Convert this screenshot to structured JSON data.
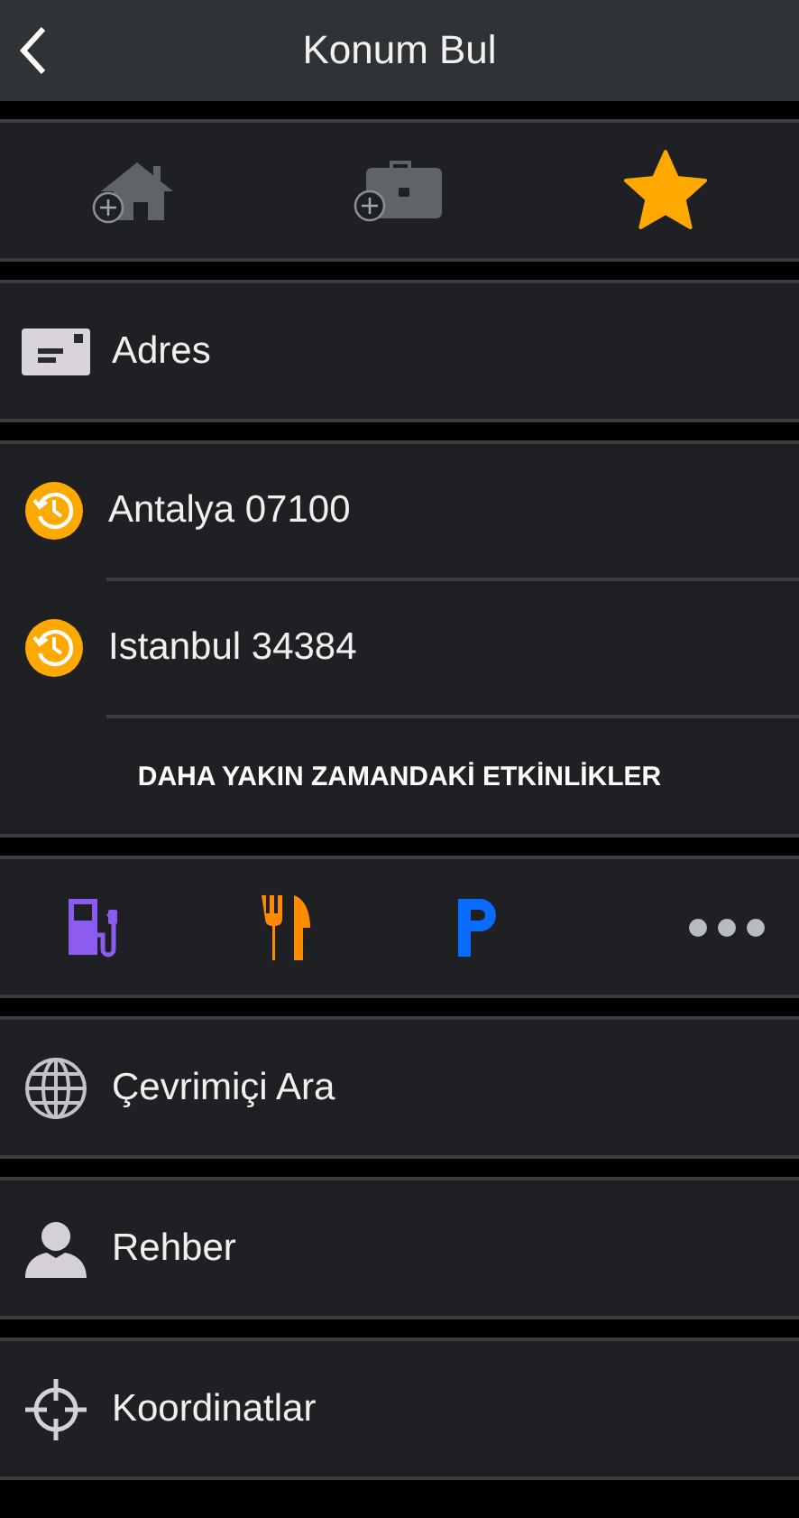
{
  "header": {
    "title": "Konum Bul"
  },
  "favorites": [
    {
      "kind": "home"
    },
    {
      "kind": "work"
    },
    {
      "kind": "star"
    }
  ],
  "address": {
    "kind": "address",
    "label": "Adres"
  },
  "recent": {
    "items": [
      {
        "label": "Antalya 07100"
      },
      {
        "label": "Istanbul 34384"
      }
    ],
    "more_link": "DAHA YAKIN ZAMANDAKİ ETKİNLİKLER"
  },
  "categories": [
    {
      "kind": "fuel"
    },
    {
      "kind": "food"
    },
    {
      "kind": "parking"
    },
    {
      "kind": "more"
    }
  ],
  "menu": [
    {
      "kind": "globe",
      "label": "Çevrimiçi Ara"
    },
    {
      "kind": "person",
      "label": "Rehber"
    },
    {
      "kind": "crosshair",
      "label": "Koordinatlar"
    }
  ]
}
